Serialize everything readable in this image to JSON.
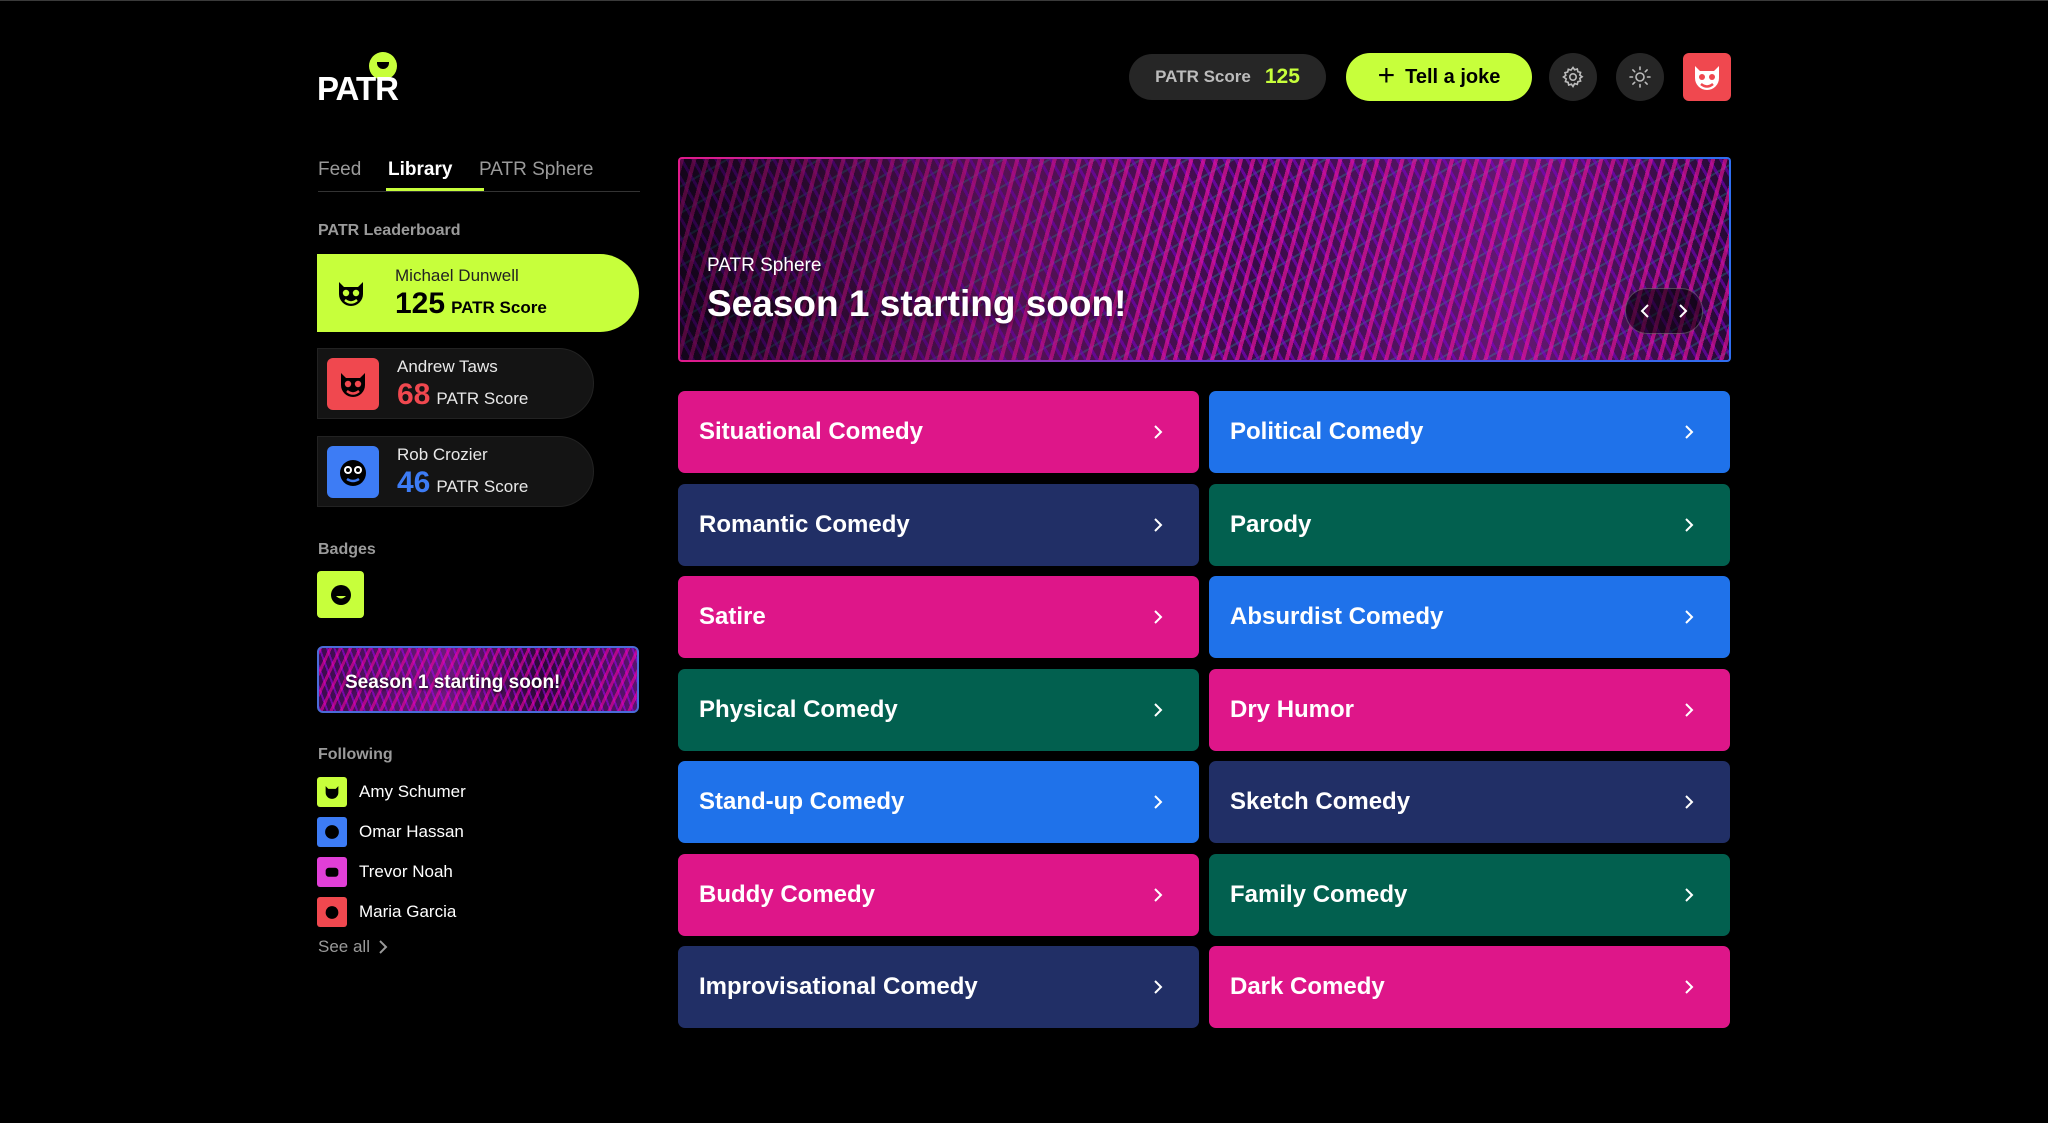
{
  "app": {
    "logo_text": "PATR"
  },
  "header": {
    "score_label": "PATR Score",
    "score_value": "125",
    "joke_button_label": "Tell a joke"
  },
  "tabs": [
    {
      "label": "Feed"
    },
    {
      "label": "Library"
    },
    {
      "label": "PATR Sphere"
    }
  ],
  "leaderboard": {
    "title": "PATR Leaderboard",
    "entries": [
      {
        "name": "Michael Dunwell",
        "score": "125",
        "unit": "PATR Score",
        "color": "#c7ff3b"
      },
      {
        "name": "Andrew Taws",
        "score": "68",
        "unit": "PATR Score",
        "color": "#f0484f"
      },
      {
        "name": "Rob Crozier",
        "score": "46",
        "unit": "PATR Score",
        "color": "#3d7cf5"
      }
    ]
  },
  "badges": {
    "title": "Badges"
  },
  "mini_banner": {
    "text": "Season 1 starting soon!"
  },
  "following": {
    "title": "Following",
    "items": [
      {
        "name": "Amy Schumer",
        "color": "#c7ff3b"
      },
      {
        "name": "Omar Hassan",
        "color": "#3d7cf5"
      },
      {
        "name": "Trevor Noah",
        "color": "#e13fd7"
      },
      {
        "name": "Maria Garcia",
        "color": "#f0484f"
      }
    ],
    "see_all": "See all"
  },
  "hero": {
    "subtitle": "PATR Sphere",
    "title": "Season 1 starting soon!"
  },
  "categories": [
    {
      "label": "Situational Comedy",
      "color": "#de1689"
    },
    {
      "label": "Political Comedy",
      "color": "#1f72ea"
    },
    {
      "label": "Romantic Comedy",
      "color": "#212f66"
    },
    {
      "label": "Parody",
      "color": "#02604f"
    },
    {
      "label": "Satire",
      "color": "#de1689"
    },
    {
      "label": "Absurdist Comedy",
      "color": "#1f72ea"
    },
    {
      "label": "Physical Comedy",
      "color": "#02604f"
    },
    {
      "label": "Dry Humor",
      "color": "#de1689"
    },
    {
      "label": "Stand-up Comedy",
      "color": "#1f72ea"
    },
    {
      "label": "Sketch Comedy",
      "color": "#212f66"
    },
    {
      "label": "Buddy Comedy",
      "color": "#de1689"
    },
    {
      "label": "Family Comedy",
      "color": "#02604f"
    },
    {
      "label": "Improvisational Comedy",
      "color": "#212f66"
    },
    {
      "label": "Dark Comedy",
      "color": "#de1689"
    }
  ]
}
